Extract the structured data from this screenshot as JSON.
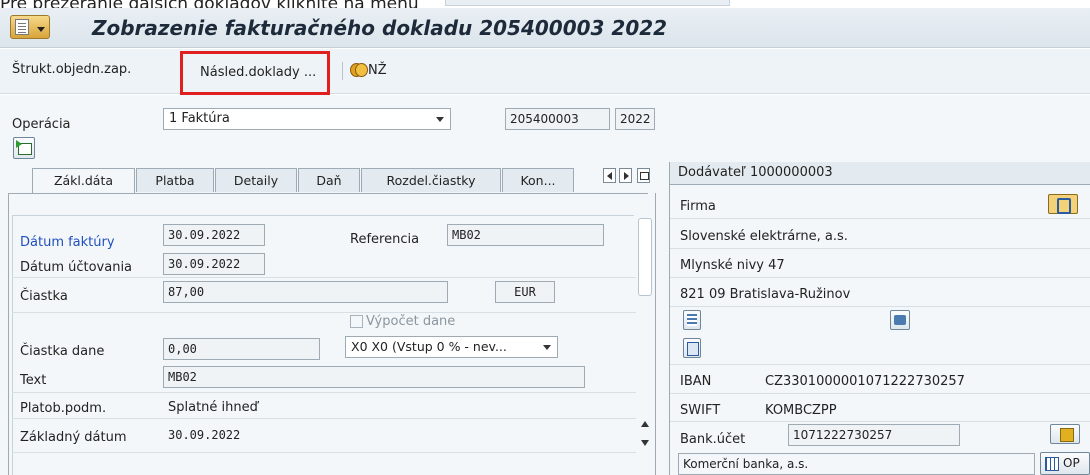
{
  "top_text": "Pre prezeranie ďalších dokladov kliknite na menu",
  "title": "Zobrazenie fakturačného dokladu 205400003 2022",
  "toolbar": {
    "struct_label": "Štrukt.objedn.zap.",
    "nasled_label": "Násled.doklady ...",
    "nz_label": "NŽ"
  },
  "header": {
    "operation_label": "Operácia",
    "operation_value": "1 Faktúra",
    "doc_number": "205400003",
    "fiscal_year": "2022"
  },
  "tabs": [
    {
      "label": "Zákl.dáta",
      "active": true
    },
    {
      "label": "Platba"
    },
    {
      "label": "Detaily"
    },
    {
      "label": "Daň"
    },
    {
      "label": "Rozdel.čiastky"
    },
    {
      "label": "Kon..."
    }
  ],
  "form": {
    "invoice_date_label": "Dátum faktúry",
    "invoice_date": "30.09.2022",
    "reference_label": "Referencia",
    "reference": "MB02",
    "posting_date_label": "Dátum účtovania",
    "posting_date": "30.09.2022",
    "amount_label": "Čiastka",
    "amount": "87,00",
    "currency": "EUR",
    "calc_tax_label": "Výpočet dane",
    "tax_amount_label": "Čiastka dane",
    "tax_amount": "0,00",
    "tax_code": "X0 X0 (Vstup 0 % - nev...",
    "text_label": "Text",
    "text": "MB02",
    "payment_terms_label": "Platob.podm.",
    "payment_terms": "Splatné ihneď",
    "baseline_date_label": "Základný dátum",
    "baseline_date": "30.09.2022"
  },
  "vendor": {
    "header": "Dodávateľ 1000000003",
    "company_label": "Firma",
    "name": "Slovenské elektrárne, a.s.",
    "street": "Mlynské nivy 47",
    "city": "821 09 Bratislava-Ružinov",
    "iban_label": "IBAN",
    "iban": "CZ3301000001071222730257",
    "swift_label": "SWIFT",
    "swift": "KOMBCZPP",
    "bank_account_label": "Bank.účet",
    "bank_account": "1071222730257",
    "bank_name": "Komerční banka, a.s.",
    "op_label": "OP"
  }
}
